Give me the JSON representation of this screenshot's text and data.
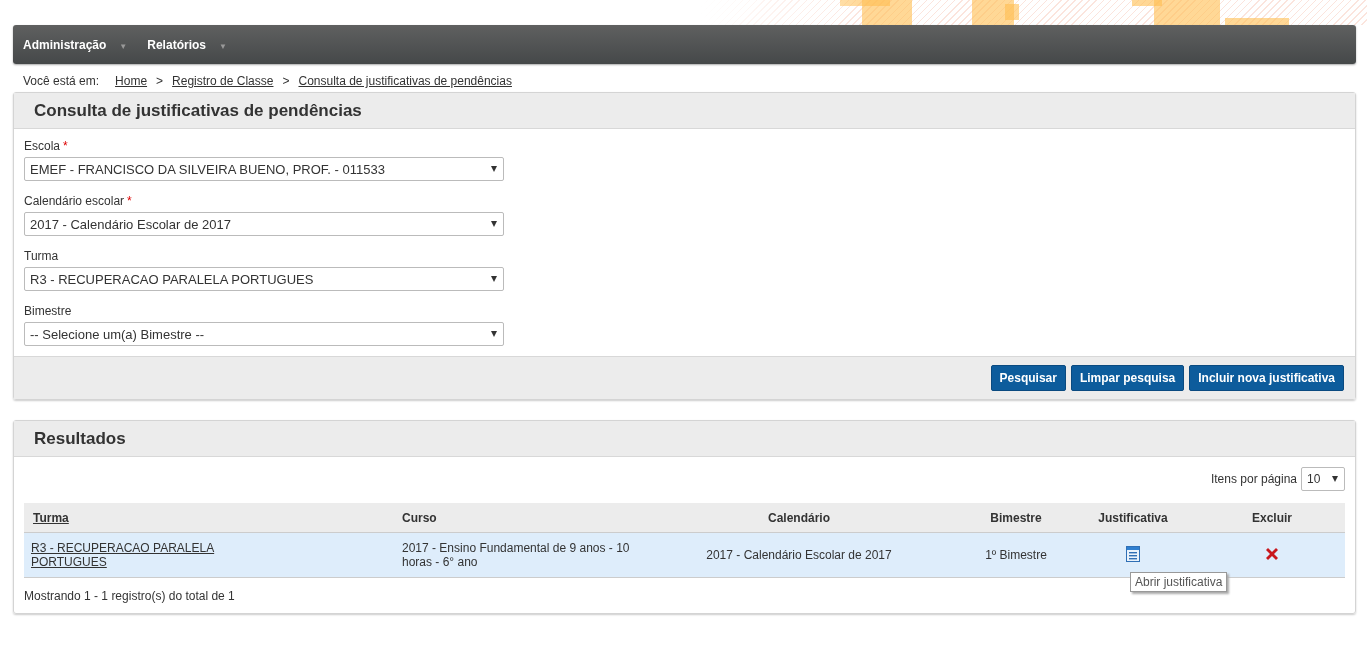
{
  "menu": [
    {
      "label": "Administração",
      "symbol": "▼"
    },
    {
      "label": "Relatórios",
      "symbol": "▼"
    }
  ],
  "breadcrumb": {
    "label": "Você está em:",
    "separator": ">",
    "items": [
      "Home",
      "Registro de Classe",
      "Consulta de justificativas de pendências"
    ]
  },
  "search_panel": {
    "title": "Consulta de justificativas de pendências",
    "fields": [
      {
        "label": "Escola",
        "required_mark": "*",
        "value": "EMEF - FRANCISCO DA SILVEIRA BUENO, PROF. - 011533"
      },
      {
        "label": "Calendário escolar",
        "required_mark": "*",
        "value": "2017 - Calendário Escolar de 2017"
      },
      {
        "label": "Turma",
        "value": "R3 - RECUPERACAO PARALELA PORTUGUES"
      },
      {
        "label": "Bimestre",
        "value": "-- Selecione um(a) Bimestre --"
      }
    ],
    "buttons": [
      "Pesquisar",
      "Limpar pesquisa",
      "Incluir nova justificativa"
    ]
  },
  "results_panel": {
    "title": "Resultados",
    "page_size_label": "Itens por página",
    "page_size": "10",
    "table": {
      "columns": [
        {
          "label": "Turma",
          "sortable": true
        },
        {
          "label": "Curso",
          "sortable": false
        },
        {
          "label": "Calendário",
          "sortable": false
        },
        {
          "label": "Bimestre",
          "sortable": false
        },
        {
          "label": "Justificativa",
          "sortable": false
        },
        {
          "label": "Excluir",
          "sortable": false
        }
      ],
      "rows": [
        {
          "turma": "R3 - RECUPERACAO PARALELA PORTUGUES",
          "curso": "2017 - Ensino Fundamental de 9 anos - 10 horas - 6° ano",
          "calendario": "2017 - Calendário Escolar de 2017",
          "bimestre": "1º Bimestre",
          "selected": true
        }
      ]
    },
    "tooltip": "Abrir justificativa",
    "summary": "Mostrando 1 - 1 registro(s) do total de 1"
  }
}
